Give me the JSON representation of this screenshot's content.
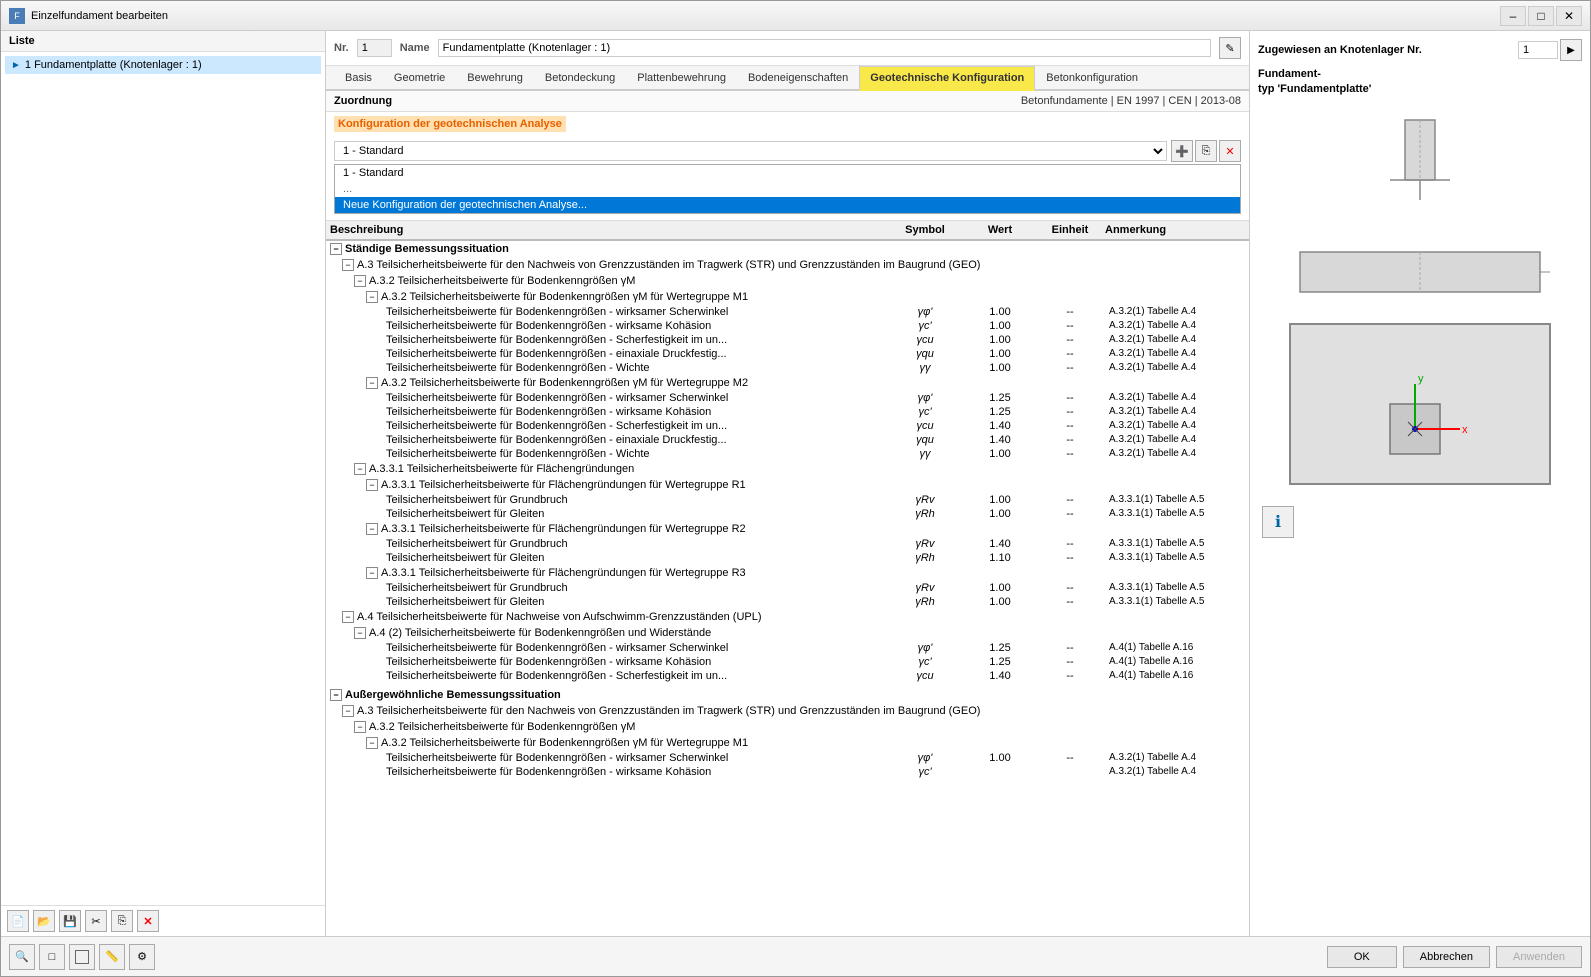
{
  "window": {
    "title": "Einzelfundament bearbeiten"
  },
  "sidebar": {
    "header": "Liste",
    "items": [
      {
        "id": 1,
        "label": "1  Fundamentplatte (Knotenlager : 1)",
        "selected": true
      }
    ],
    "buttons": [
      "new",
      "open",
      "save",
      "cut",
      "copy",
      "delete"
    ]
  },
  "form": {
    "nr_label": "Nr.",
    "nr_value": "1",
    "name_label": "Name",
    "name_value": "Fundamentplatte (Knotenlager : 1)"
  },
  "tabs": [
    {
      "id": "basis",
      "label": "Basis"
    },
    {
      "id": "geometrie",
      "label": "Geometrie"
    },
    {
      "id": "bewehrung",
      "label": "Bewehrung"
    },
    {
      "id": "betondeckung",
      "label": "Betondeckung"
    },
    {
      "id": "plattenbewehrung",
      "label": "Plattenbewehrung"
    },
    {
      "id": "bodeneigenschaften",
      "label": "Bodeneigenschaften"
    },
    {
      "id": "geotechnische_konfiguration",
      "label": "Geotechnische Konfiguration",
      "active": true
    },
    {
      "id": "betonkonfiguration",
      "label": "Betonkonfiguration"
    }
  ],
  "zuordnung": {
    "label": "Zuordnung",
    "norm": "Betonfundamente | EN 1997 | CEN | 2013-08"
  },
  "konfiguration": {
    "label": "Konfiguration der geotechnischen Analyse",
    "dropdown_value": "1 - Standard",
    "dropdown_options": [
      "1 - Standard"
    ],
    "dropdown_highlight": "Neue Konfiguration der geotechnischen Analyse...",
    "dropdown_item": "1 - Standard"
  },
  "table": {
    "columns": [
      "Beschreibung",
      "Symbol",
      "Wert",
      "Einheit",
      "Anmerkung"
    ],
    "sections": [
      {
        "id": "staendige",
        "label": "Ständige Bemessungssituation",
        "level": 0,
        "expanded": true,
        "children": [
          {
            "id": "a3_str_geo",
            "label": "A.3 Teilsicherheitsbeiwerte für den Nachweis von Grenzzuständen im Tragwerk (STR) und Grenzzuständen im Baugrund (GEO)",
            "level": 1,
            "expanded": true,
            "children": [
              {
                "id": "a3_2_ym",
                "label": "A.3.2 Teilsicherheitsbeiwerte für Bodenkenngrößen γM",
                "level": 2,
                "expanded": true,
                "children": [
                  {
                    "id": "a3_2_m1",
                    "label": "A.3.2 Teilsicherheitsbeiwerte für Bodenkenngrößen γM für Wertegruppe M1",
                    "level": 3,
                    "expanded": true,
                    "rows": [
                      {
                        "desc": "Teilsicherheitsbeiwerte für Bodenkenngrößen - wirksamer Scherwinkel",
                        "sym": "γφ'",
                        "val": "1.00",
                        "unit": "--",
                        "note": "A.3.2(1) Tabelle A.4"
                      },
                      {
                        "desc": "Teilsicherheitsbeiwerte für Bodenkenngrößen - wirksame Kohäsion",
                        "sym": "γc'",
                        "val": "1.00",
                        "unit": "--",
                        "note": "A.3.2(1) Tabelle A.4"
                      },
                      {
                        "desc": "Teilsicherheitsbeiwerte für Bodenkenngrößen - Scherfestigkeit im un...",
                        "sym": "γcu",
                        "val": "1.00",
                        "unit": "--",
                        "note": "A.3.2(1) Tabelle A.4"
                      },
                      {
                        "desc": "Teilsicherheitsbeiwerte für Bodenkenngrößen - einaxiale Druckfestig...",
                        "sym": "γqu",
                        "val": "1.00",
                        "unit": "--",
                        "note": "A.3.2(1) Tabelle A.4"
                      },
                      {
                        "desc": "Teilsicherheitsbeiwerte für Bodenkenngrößen - Wichte",
                        "sym": "γγ",
                        "val": "1.00",
                        "unit": "--",
                        "note": "A.3.2(1) Tabelle A.4"
                      }
                    ]
                  },
                  {
                    "id": "a3_2_m2",
                    "label": "A.3.2 Teilsicherheitsbeiwerte für Bodenkenngrößen γM für Wertegruppe M2",
                    "level": 3,
                    "expanded": true,
                    "rows": [
                      {
                        "desc": "Teilsicherheitsbeiwerte für Bodenkenngrößen - wirksamer Scherwinkel",
                        "sym": "γφ'",
                        "val": "1.25",
                        "unit": "--",
                        "note": "A.3.2(1) Tabelle A.4"
                      },
                      {
                        "desc": "Teilsicherheitsbeiwerte für Bodenkenngrößen - wirksame Kohäsion",
                        "sym": "γc'",
                        "val": "1.25",
                        "unit": "--",
                        "note": "A.3.2(1) Tabelle A.4"
                      },
                      {
                        "desc": "Teilsicherheitsbeiwerte für Bodenkenngrößen - Scherfestigkeit im un...",
                        "sym": "γcu",
                        "val": "1.40",
                        "unit": "--",
                        "note": "A.3.2(1) Tabelle A.4"
                      },
                      {
                        "desc": "Teilsicherheitsbeiwerte für Bodenkenngrößen - einaxiale Druckfestig...",
                        "sym": "γqu",
                        "val": "1.40",
                        "unit": "--",
                        "note": "A.3.2(1) Tabelle A.4"
                      },
                      {
                        "desc": "Teilsicherheitsbeiwerte für Bodenkenngrößen - Wichte",
                        "sym": "γγ",
                        "val": "1.00",
                        "unit": "--",
                        "note": "A.3.2(1) Tabelle A.4"
                      }
                    ]
                  }
                ]
              }
            ]
          },
          {
            "id": "a3_3_1_flaechen",
            "label": "A.3.3.1 Teilsicherheitsbeiwerte für Flächengründungen",
            "level": 2,
            "expanded": true,
            "children": [
              {
                "id": "a3_3_1_r1",
                "label": "A.3.3.1 Teilsicherheitsbeiwerte für Flächengründungen für Wertegruppe R1",
                "level": 3,
                "expanded": true,
                "rows": [
                  {
                    "desc": "Teilsicherheitsbeiwert für Grundbruch",
                    "sym": "γRv",
                    "val": "1.00",
                    "unit": "--",
                    "note": "A.3.3.1(1) Tabelle A.5"
                  },
                  {
                    "desc": "Teilsicherheitsbeiwert für Gleiten",
                    "sym": "γRh",
                    "val": "1.00",
                    "unit": "--",
                    "note": "A.3.3.1(1) Tabelle A.5"
                  }
                ]
              },
              {
                "id": "a3_3_1_r2",
                "label": "A.3.3.1 Teilsicherheitsbeiwerte für Flächengründungen für Wertegruppe R2",
                "level": 3,
                "expanded": true,
                "rows": [
                  {
                    "desc": "Teilsicherheitsbeiwert für Grundbruch",
                    "sym": "γRv",
                    "val": "1.40",
                    "unit": "--",
                    "note": "A.3.3.1(1) Tabelle A.5"
                  },
                  {
                    "desc": "Teilsicherheitsbeiwert für Gleiten",
                    "sym": "γRh",
                    "val": "1.10",
                    "unit": "--",
                    "note": "A.3.3.1(1) Tabelle A.5"
                  }
                ]
              },
              {
                "id": "a3_3_1_r3",
                "label": "A.3.3.1 Teilsicherheitsbeiwerte für Flächengründungen für Wertegruppe R3",
                "level": 3,
                "expanded": true,
                "rows": [
                  {
                    "desc": "Teilsicherheitsbeiwert für Grundbruch",
                    "sym": "γRv",
                    "val": "1.00",
                    "unit": "--",
                    "note": "A.3.3.1(1) Tabelle A.5"
                  },
                  {
                    "desc": "Teilsicherheitsbeiwert für Gleiten",
                    "sym": "γRh",
                    "val": "1.00",
                    "unit": "--",
                    "note": "A.3.3.1(1) Tabelle A.5"
                  }
                ]
              }
            ]
          },
          {
            "id": "a4_upl",
            "label": "A.4 Teilsicherheitsbeiwerte für Nachweise von Aufschwimm-Grenzzuständen (UPL)",
            "level": 2,
            "expanded": true,
            "children": [
              {
                "id": "a4_2",
                "label": "A.4 (2) Teilsicherheitsbeiwerte für Bodenkenngrößen und Widerstände",
                "level": 3,
                "expanded": true,
                "rows": [
                  {
                    "desc": "Teilsicherheitsbeiwerte für Bodenkenngrößen - wirksamer Scherwinkel",
                    "sym": "γφ'",
                    "val": "1.25",
                    "unit": "--",
                    "note": "A.4(1) Tabelle A.16"
                  },
                  {
                    "desc": "Teilsicherheitsbeiwerte für Bodenkenngrößen - wirksame Kohäsion",
                    "sym": "γc'",
                    "val": "1.25",
                    "unit": "--",
                    "note": "A.4(1) Tabelle A.16"
                  },
                  {
                    "desc": "Teilsicherheitsbeiwerte für Bodenkenngrößen - Scherfestigkeit im un...",
                    "sym": "γcu",
                    "val": "1.40",
                    "unit": "--",
                    "note": "A.4(1) Tabelle A.16"
                  }
                ]
              }
            ]
          }
        ]
      },
      {
        "id": "aussergewoehnliche",
        "label": "Außergewöhnliche Bemessungssituation",
        "level": 0,
        "expanded": true,
        "children": [
          {
            "id": "a3_str_geo_ag",
            "label": "A.3 Teilsicherheitsbeiwerte für den Nachweis von Grenzzuständen im Tragwerk (STR) und Grenzzuständen im Baugrund (GEO)",
            "level": 1,
            "expanded": true,
            "children": [
              {
                "id": "a3_2_ym_ag",
                "label": "A.3.2 Teilsicherheitsbeiwerte für Bodenkenngrößen γM",
                "level": 2,
                "expanded": true,
                "children": [
                  {
                    "id": "a3_2_m1_ag",
                    "label": "A.3.2 Teilsicherheitsbeiwerte für Bodenkenngrößen γM für Wertegruppe M1",
                    "level": 3,
                    "expanded": true,
                    "rows": [
                      {
                        "desc": "Teilsicherheitsbeiwerte für Bodenkenngrößen - wirksamer Scherwinkel",
                        "sym": "γφ'",
                        "val": "1.00",
                        "unit": "--",
                        "note": "A.3.2(1) Tabelle A.4"
                      },
                      {
                        "desc": "Teilsicherheitsbeiwerte für Bodenkenngrößen - wirksame Kohäsion",
                        "sym": "γc'",
                        "val": "",
                        "unit": "",
                        "note": "A.3.2(1) Tabelle A.4"
                      }
                    ]
                  }
                ]
              }
            ]
          }
        ]
      }
    ]
  },
  "right_panel": {
    "zugewiesen_label": "Zugewiesen an Knotenlager Nr.",
    "zugewiesen_nr": "1",
    "fundamental_typ_label": "Fundament-\ntyp 'Fundamentplatte'"
  },
  "bottom_toolbar": {
    "tools": [
      "zoom-search",
      "object",
      "rectangle-select",
      "measure",
      "info"
    ],
    "ok_label": "OK",
    "cancel_label": "Abbrechen",
    "apply_label": "Anwenden"
  }
}
